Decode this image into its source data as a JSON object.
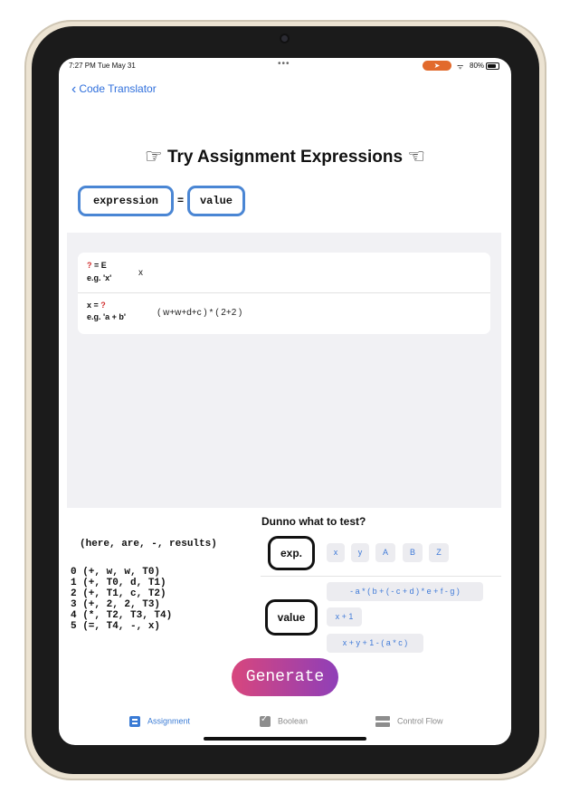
{
  "status_bar": {
    "time": "7:27 PM  Tue May 31",
    "dots": "•••",
    "pill_icon": "swift-icon",
    "wifi": "ᯤ",
    "battery": "80%"
  },
  "nav": {
    "back_label": "Code Translator"
  },
  "header": {
    "title": "Try Assignment Expressions",
    "left_hand": "☞",
    "right_hand": "☜"
  },
  "syntax": {
    "left_token": "expression",
    "eq": "=",
    "right_token": "value"
  },
  "inputs": {
    "variable_row": {
      "qmark": "?",
      "label_suffix": " = E",
      "example": "e.g. 'x'",
      "value": "x"
    },
    "value_row": {
      "label_prefix": "x = ",
      "qmark": "?",
      "example": "e.g. 'a + b'",
      "value": "( w+w+d+c ) * ( 2+2 )"
    }
  },
  "results": {
    "header": "(here, are, -, results)",
    "lines": [
      "0 (+, w, w, T0)",
      "1 (+, T0, d, T1)",
      "2 (+, T1, c, T2)",
      "3 (+, 2, 2, T3)",
      "4 (*, T2, T3, T4)",
      "5 (=, T4, -, x)"
    ]
  },
  "suggestions": {
    "title": "Dunno what to test?",
    "exp_label": "exp.",
    "exp_chips": [
      "x",
      "y",
      "A",
      "B",
      "Z"
    ],
    "value_label": "value",
    "value_chips": [
      "- a * ( b + ( - c + d ) * e + f - g )",
      "x + 1",
      "x + y + 1 - ( a * c )"
    ]
  },
  "generate_label": "Generate",
  "tabs": [
    {
      "label": "Assignment",
      "icon": "assignment-icon",
      "active": true
    },
    {
      "label": "Boolean",
      "icon": "checkbox-icon",
      "active": false
    },
    {
      "label": "Control Flow",
      "icon": "control-flow-icon",
      "active": false
    }
  ],
  "colors": {
    "accent": "#3a7bd5",
    "token_border": "#4a86d4",
    "question_mark": "#d12d2d",
    "generate_start": "#d8467d",
    "generate_end": "#8f3fb8",
    "status_pill": "#e26a2c"
  }
}
